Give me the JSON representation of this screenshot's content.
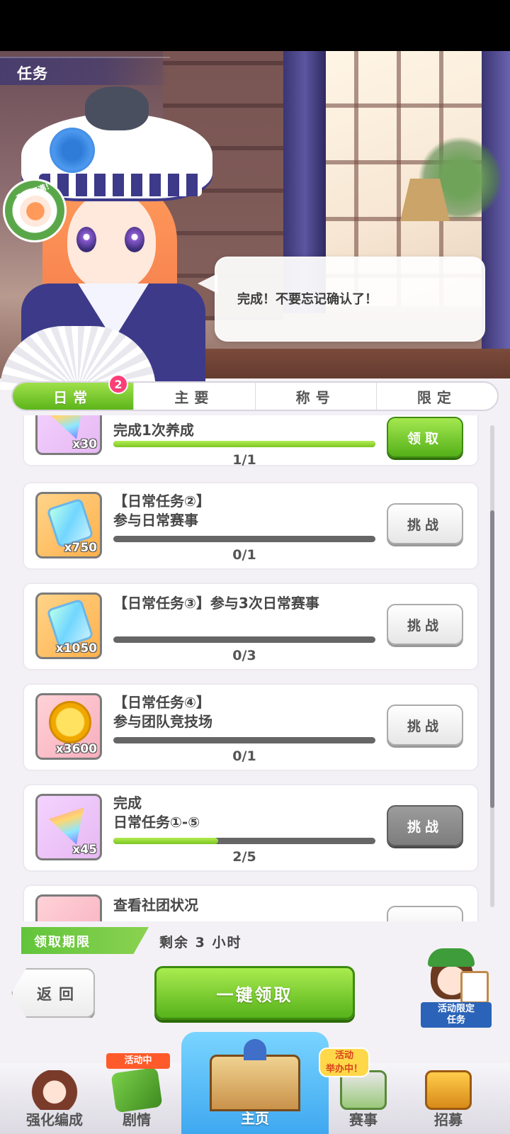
{
  "screen": {
    "title": "任务"
  },
  "scene": {
    "badge_label": "事件圆满！",
    "speech": "完成！不要忘记确认了！"
  },
  "tabs": [
    {
      "label": "日常",
      "badge": "2",
      "active": true
    },
    {
      "label": "主要",
      "active": false
    },
    {
      "label": "称号",
      "active": false
    },
    {
      "label": "限定",
      "active": false
    }
  ],
  "tasks": [
    {
      "title": "完成1次养成",
      "reward_icon": "carrot-icon",
      "reward_qty": "x30",
      "progress_text": "1/1",
      "progress": 1.0,
      "button": "领取",
      "button_state": "claim"
    },
    {
      "title": "【日常任务②】\n参与日常赛事",
      "reward_icon": "gem-card-icon",
      "reward_qty": "x750",
      "progress_text": "0/1",
      "progress": 0.0,
      "button": "挑战",
      "button_state": "challenge"
    },
    {
      "title": "【日常任务③】参与3次日常赛事",
      "reward_icon": "gem-card-icon",
      "reward_qty": "x1050",
      "progress_text": "0/3",
      "progress": 0.0,
      "button": "挑战",
      "button_state": "challenge"
    },
    {
      "title": "【日常任务④】\n参与团队竞技场",
      "reward_icon": "gold-coin-icon",
      "reward_qty": "x3600",
      "progress_text": "0/1",
      "progress": 0.0,
      "button": "挑战",
      "button_state": "challenge"
    },
    {
      "title": "完成\n日常任务①-⑤",
      "reward_icon": "carrot-icon",
      "reward_qty": "x45",
      "progress_text": "2/5",
      "progress": 0.4,
      "button": "挑战",
      "button_state": "disabled"
    },
    {
      "title": "查看社团状况",
      "reward_icon": "carrot-icon",
      "reward_qty": "",
      "progress_text": "",
      "progress": 0.0,
      "button": "",
      "button_state": "challenge"
    }
  ],
  "deadline": {
    "label": "领取期限",
    "value": "剩余 3 小时"
  },
  "actions": {
    "back": "返回",
    "claim_all": "一键领取",
    "event_task": "活动限定\n任务"
  },
  "nav": [
    {
      "label": "强化编成"
    },
    {
      "label": "剧情",
      "tag": "活动中"
    },
    {
      "label": "主页"
    },
    {
      "label": "赛事",
      "tag": "活动\n举办中！"
    },
    {
      "label": "招募"
    }
  ],
  "colors": {
    "accent_green": "#5cb51a",
    "tab_badge": "#ff3e78",
    "progress_fill": "#7ac623"
  }
}
